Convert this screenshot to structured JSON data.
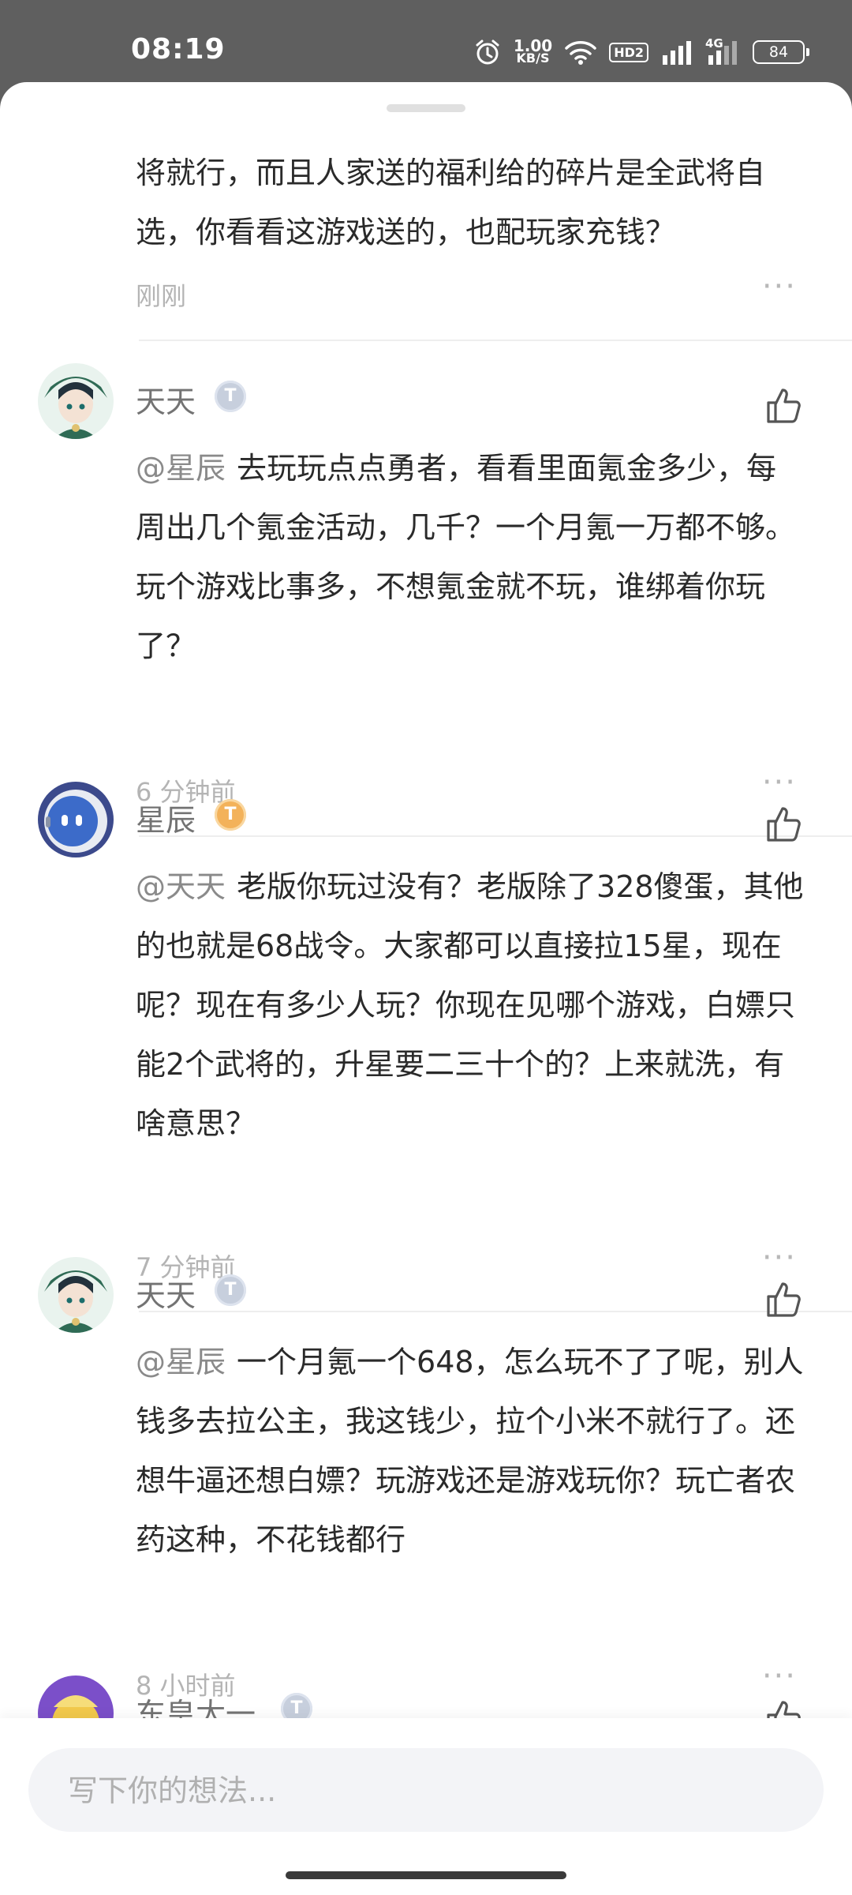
{
  "status_bar": {
    "time": "08:19",
    "net_speed_value": "1.00",
    "net_speed_unit": "KB/S",
    "hd_label": "HD2",
    "signal_label": "4G",
    "battery": "84"
  },
  "continued_comment": {
    "text": "将就行，而且人家送的福利给的碎片是全武将自选，你看看这游戏送的，也配玩家充钱？",
    "time": "刚刚"
  },
  "comments": [
    {
      "username": "天天",
      "level": "T",
      "mention": "@星辰",
      "text": "去玩玩点点勇者，看看里面氪金多少，每周出几个氪金活动，几千？一个月氪一万都不够。玩个游戏比事多，不想氪金就不玩，谁绑着你玩了？",
      "time": "6 分钟前"
    },
    {
      "username": "星辰",
      "level": "T",
      "mention": "@天天",
      "text": "老版你玩过没有？老版除了328傻蛋，其他的也就是68战令。大家都可以直接拉15星，现在呢？现在有多少人玩？你现在见哪个游戏，白嫖只能2个武将的，升星要二三十个的？上来就洗，有啥意思？",
      "time": "7 分钟前"
    },
    {
      "username": "天天",
      "level": "T",
      "mention": "@星辰",
      "text": "一个月氪一个648，怎么玩不了了呢，别人钱多去拉公主，我这钱少，拉个小米不就行了。还想牛逼还想白嫖？玩游戏还是游戏玩你？玩亡者农药这种，不花钱都行",
      "time": "8 小时前"
    },
    {
      "username": "东皇太一",
      "level": "T"
    }
  ],
  "more_label": "···",
  "input": {
    "placeholder": "写下你的想法..."
  }
}
